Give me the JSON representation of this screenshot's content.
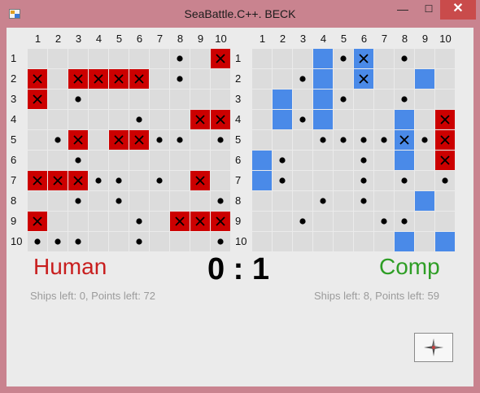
{
  "window": {
    "title": "SeaBattle.C++. BECK",
    "minimize_symbol": "—",
    "maximize_symbol": "☐",
    "close_symbol": "✕",
    "app_icon": "app-icon"
  },
  "column_labels": [
    "1",
    "2",
    "3",
    "4",
    "5",
    "6",
    "7",
    "8",
    "9",
    "10"
  ],
  "row_labels": [
    "1",
    "2",
    "3",
    "4",
    "5",
    "6",
    "7",
    "8",
    "9",
    "10"
  ],
  "human_board": {
    "rows": [
      "·······oH",
      "",
      "",
      "",
      "",
      "",
      "",
      "",
      "",
      ""
    ]
  },
  "boards": {
    "legend": {
      ".": "empty",
      "o": "miss",
      "H": "hit",
      "S": "ship",
      "X": "sunk-on-ship"
    },
    "human": [
      ".......o.H",
      "H.HHHH.o..",
      "H.o.......",
      ".....o..HH",
      ".oH.HHoo.o",
      "..o.......",
      "HHHoo.o.H.",
      "..o.o....o",
      "H....o.HHH",
      "ooo..o...o"
    ],
    "comp": [
      "...SoX.o..",
      "..oS.X..S.",
      ".S.So..o..",
      ".SoS...S.H",
      "...ooooXoH",
      "So...o.S.H",
      "So...o.o.o",
      "...o.o..S.",
      "..o...oo..",
      ".......S.S"
    ]
  },
  "players": {
    "human": {
      "name": "Human",
      "status": "Ships left: 0, Points left: 72",
      "color": "#c81e1e"
    },
    "comp": {
      "name": "Comp",
      "status": "Ships left: 8, Points left: 59",
      "color": "#2e9e25"
    }
  },
  "score": "0 : 1",
  "colors": {
    "hit": "#cc0000",
    "ship": "#4a8ae8",
    "empty": "#dcdcdc",
    "background": "#ebebeb"
  },
  "compass_button": {
    "icon": "compass-icon"
  }
}
